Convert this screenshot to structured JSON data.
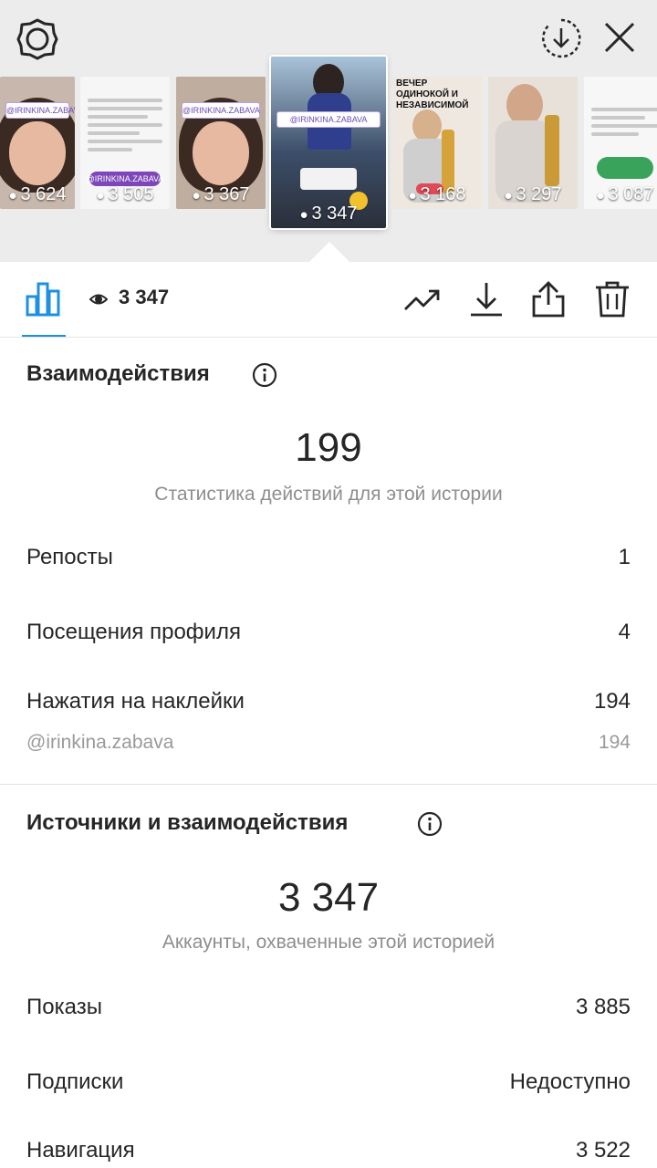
{
  "story_strip": {
    "thumbnails": [
      {
        "views": "3 624",
        "tag": "@IRINKINA.ZABAVA"
      },
      {
        "views": "3 505",
        "tag": "@IRINKINA.ZABAVA"
      },
      {
        "views": "3 367",
        "tag": "@IRINKINA.ZABAVA"
      },
      {
        "views": "3 347",
        "tag": "@IRINKINA.ZABAVA",
        "selected": true
      },
      {
        "views": "3 168",
        "tag": "ВЕЧЕР ОДИНОКОЙ И НЕЗАВИСИМОЙ"
      },
      {
        "views": "3 297",
        "tag": ""
      },
      {
        "views": "3 087",
        "tag": ""
      }
    ]
  },
  "toolbar": {
    "views_count": "3 347"
  },
  "interactions": {
    "title": "Взаимодействия",
    "total": "199",
    "subtitle": "Статистика действий для этой истории",
    "rows": [
      {
        "label": "Репосты",
        "value": "1"
      },
      {
        "label": "Посещения профиля",
        "value": "4"
      },
      {
        "label": "Нажатия на наклейки",
        "value": "194"
      }
    ],
    "sticker_detail": {
      "label": "@irinkina.zabava",
      "value": "194"
    }
  },
  "discovery": {
    "title": "Источники и взаимодействия",
    "total": "3 347",
    "subtitle": "Аккаунты, охваченные этой историей",
    "rows": [
      {
        "label": "Показы",
        "value": "3 885"
      },
      {
        "label": "Подписки",
        "value": "Недоступно"
      },
      {
        "label": "Навигация",
        "value": "3 522"
      }
    ]
  },
  "colors": {
    "accent_blue": "#1e90e0",
    "strip_background": "#ececec",
    "text_primary": "#262626",
    "text_secondary": "#8e8e8e"
  },
  "icons": [
    "settings-icon",
    "download-circle-icon",
    "close-icon",
    "bar-chart-icon",
    "eye-icon",
    "trend-icon",
    "download-icon",
    "share-icon",
    "trash-icon",
    "info-icon"
  ]
}
